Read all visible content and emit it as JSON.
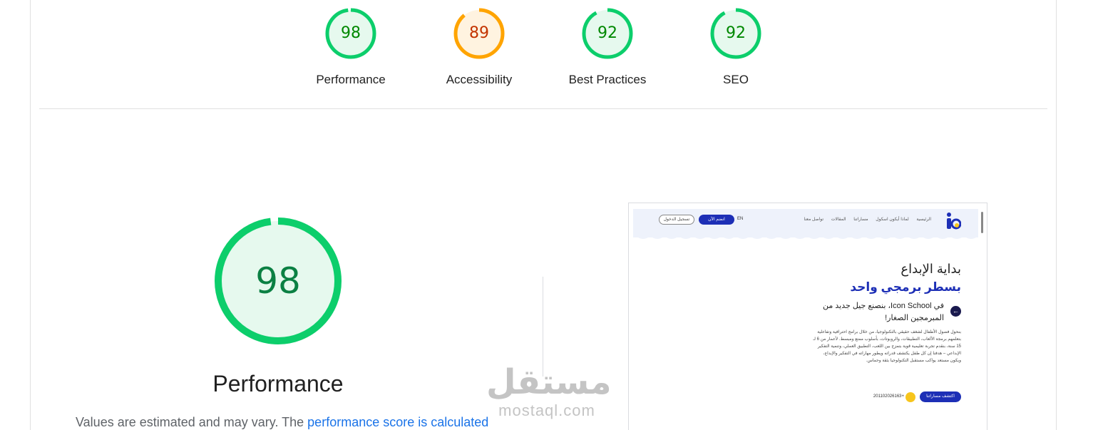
{
  "colors": {
    "pass": "#0cce6b",
    "pass_bg": "#e6f9ee",
    "pass_text": "#008800",
    "average": "#ffa400",
    "average_bg": "#fff3e0",
    "average_text": "#c33300",
    "link": "#1a73e8"
  },
  "gauges": [
    {
      "score": "98",
      "value": 98,
      "label": "Performance",
      "rating": "pass"
    },
    {
      "score": "89",
      "value": 89,
      "label": "Accessibility",
      "rating": "average"
    },
    {
      "score": "92",
      "value": 92,
      "label": "Best Practices",
      "rating": "pass"
    },
    {
      "score": "92",
      "value": 92,
      "label": "SEO",
      "rating": "pass"
    }
  ],
  "performance": {
    "score": "98",
    "value": 98,
    "title": "Performance",
    "desc_text": "Values are estimated and may vary. The ",
    "desc_link": "performance score is calculated"
  },
  "watermark": {
    "arabic": "مستقل",
    "latin": "mostaql.com"
  },
  "screenshot": {
    "nav": [
      "الرئيسية",
      "لماذا أيكون اسكول",
      "مساراتنا",
      "المقالات",
      "تواصل معنا"
    ],
    "lang": "EN",
    "join_button": "انضم الآن",
    "login_button": "تسجيل الدخول",
    "headline_1": "بداية الإبداع",
    "headline_2": "بسطر برمجي واحد",
    "subheadline": "في Icon School، بنصنع جيل جديد من المبرمجين الصغار!",
    "paragraph": "بنحول فضول الأطفال لشغف حقيقي بالتكنولوجيا، من خلال برامج احترافية وتفاعلية بتعلمهم برمجة الألعاب، التطبيقات، والروبوتات، بأسلوب ممتع ومبسط. لأعمار من 6 لـ 15 سنة، بنقدم تجربة تعليمية قوية بتمزج بين اللعب، التطبيق العملي، وتنمية التفكير الإبداعي – هدفنا إن كل طفل يكتشف قدراته ويطور مهاراته في التفكير والإبداع، ويكون مستعد يواكب مستقبل التكنولوجيا بثقة وحماس.",
    "discover_button": "اكتشف مساراتنا",
    "phone": "201102026163+"
  }
}
